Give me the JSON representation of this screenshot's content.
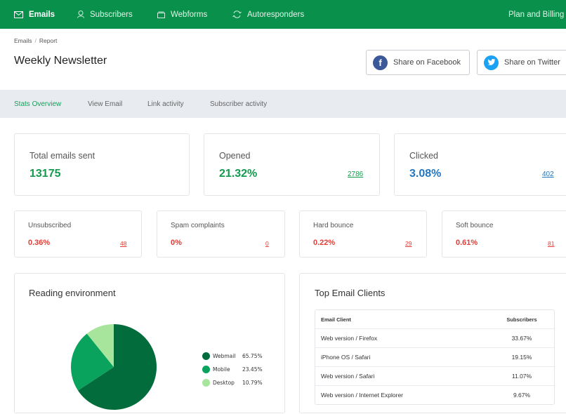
{
  "topnav": {
    "items": [
      {
        "label": "Emails",
        "icon": "envelope-icon",
        "active": true
      },
      {
        "label": "Subscribers",
        "icon": "user-icon",
        "active": false
      },
      {
        "label": "Webforms",
        "icon": "form-icon",
        "active": false
      },
      {
        "label": "Autoresponders",
        "icon": "refresh-icon",
        "active": false
      }
    ],
    "right_link": "Plan and Billing",
    "brand_color": "#09904b"
  },
  "breadcrumb": {
    "items": [
      "Emails",
      "Report"
    ],
    "separator": "/"
  },
  "page_title": "Weekly Newsletter",
  "share": {
    "facebook": {
      "label": "Share on Facebook",
      "icon": "facebook-icon",
      "color": "#3b5998"
    },
    "twitter": {
      "label": "Share on Twitter",
      "icon": "twitter-icon",
      "color": "#1da1f2"
    }
  },
  "tabs": [
    {
      "label": "Stats Overview",
      "active": true
    },
    {
      "label": "View Email",
      "active": false
    },
    {
      "label": "Link activity",
      "active": false
    },
    {
      "label": "Subscriber activity",
      "active": false
    }
  ],
  "stats": {
    "total": {
      "label": "Total emails sent",
      "value": "13175"
    },
    "opened": {
      "label": "Opened",
      "value": "21.32%",
      "count": "2786"
    },
    "clicked": {
      "label": "Clicked",
      "value": "3.08%",
      "count": "402"
    }
  },
  "small_stats": [
    {
      "label": "Unsubscribed",
      "value": "0.36%",
      "count": "48"
    },
    {
      "label": "Spam complaints",
      "value": "0%",
      "count": "0"
    },
    {
      "label": "Hard bounce",
      "value": "0.22%",
      "count": "29"
    },
    {
      "label": "Soft bounce",
      "value": "0.61%",
      "count": "81"
    }
  ],
  "reading_environment": {
    "title": "Reading environment"
  },
  "chart_data": {
    "type": "pie",
    "title": "Reading environment",
    "categories": [
      "Webmail",
      "Mobile",
      "Desktop"
    ],
    "values": [
      65.75,
      23.45,
      10.79
    ],
    "labels": [
      "65.75%",
      "23.45%",
      "10.79%"
    ],
    "colors": [
      "#036c3c",
      "#0aa35d",
      "#a8e59c"
    ],
    "legend": "right"
  },
  "top_clients": {
    "title": "Top Email Clients",
    "columns": [
      "Email Client",
      "Subscribers"
    ],
    "rows": [
      {
        "client": "Web version / Firefox",
        "subscribers": "33.67%"
      },
      {
        "client": "iPhone OS / Safari",
        "subscribers": "19.15%"
      },
      {
        "client": "Web version / Safari",
        "subscribers": "11.07%"
      },
      {
        "client": "Web version / Internet Explorer",
        "subscribers": "9.67%"
      }
    ]
  }
}
